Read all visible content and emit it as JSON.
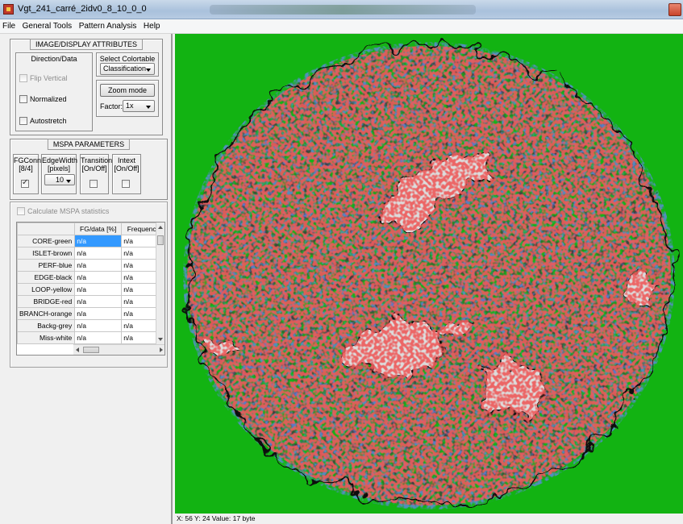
{
  "window": {
    "title": "Vgt_241_carré_2idv0_8_10_0_0",
    "accent": "#c8432b"
  },
  "menu": [
    "File",
    "General Tools",
    "Pattern Analysis",
    "Help"
  ],
  "display_attributes": {
    "title": "IMAGE/DISPLAY ATTRIBUTES",
    "direction_data": {
      "title": "Direction/Data",
      "flip_vertical": {
        "label": "Flip Vertical",
        "checked": false,
        "enabled": false
      },
      "normalized": {
        "label": "Normalized",
        "checked": false
      },
      "autostretch": {
        "label": "Autostretch",
        "checked": false
      }
    },
    "colortable": {
      "title": "Select Colortable",
      "selected": "Classification"
    },
    "zoom": {
      "button_label": "Zoom mode",
      "factor_label": "Factor:",
      "factor_value": "1x"
    }
  },
  "mspa": {
    "title": "MSPA PARAMETERS",
    "fgconn": {
      "header_line1": "FGConn",
      "header_line2": "[8/4]",
      "checked": true
    },
    "edgewidth": {
      "header_line1": "EdgeWidth",
      "header_line2": "[pixels]",
      "value": "10"
    },
    "transition": {
      "header_line1": "Transition",
      "header_line2": "[On/Off]",
      "checked": false
    },
    "intext": {
      "header_line1": "Intext",
      "header_line2": "[On/Off]",
      "checked": false
    }
  },
  "statistics": {
    "calc_label": "Calculate MSPA statistics",
    "columns": [
      "FG/data [%]",
      "Frequenc"
    ],
    "rows": [
      {
        "name": "CORE-green",
        "fg": "n/a",
        "freq": "n/a"
      },
      {
        "name": "ISLET-brown",
        "fg": "n/a",
        "freq": "n/a"
      },
      {
        "name": "PERF-blue",
        "fg": "n/a",
        "freq": "n/a"
      },
      {
        "name": "EDGE-black",
        "fg": "n/a",
        "freq": "n/a"
      },
      {
        "name": "LOOP-yellow",
        "fg": "n/a",
        "freq": "n/a"
      },
      {
        "name": "BRIDGE-red",
        "fg": "n/a",
        "freq": "n/a"
      },
      {
        "name": "BRANCH-orange",
        "fg": "n/a",
        "freq": "n/a"
      },
      {
        "name": "Backg-grey",
        "fg": "n/a",
        "freq": "n/a"
      },
      {
        "name": "Miss-white",
        "fg": "n/a",
        "freq": "n/a"
      }
    ]
  },
  "image": {
    "colors": {
      "core": "#12b312",
      "background": "#dcdcdc",
      "edge": "#0a0a0a",
      "perforation": "#1f3fd0",
      "bridge": "#d01818",
      "loop": "#e8e020",
      "branch": "#f08020"
    }
  },
  "status": {
    "text": "X: 56   Y: 24   Value: 17 byte"
  }
}
